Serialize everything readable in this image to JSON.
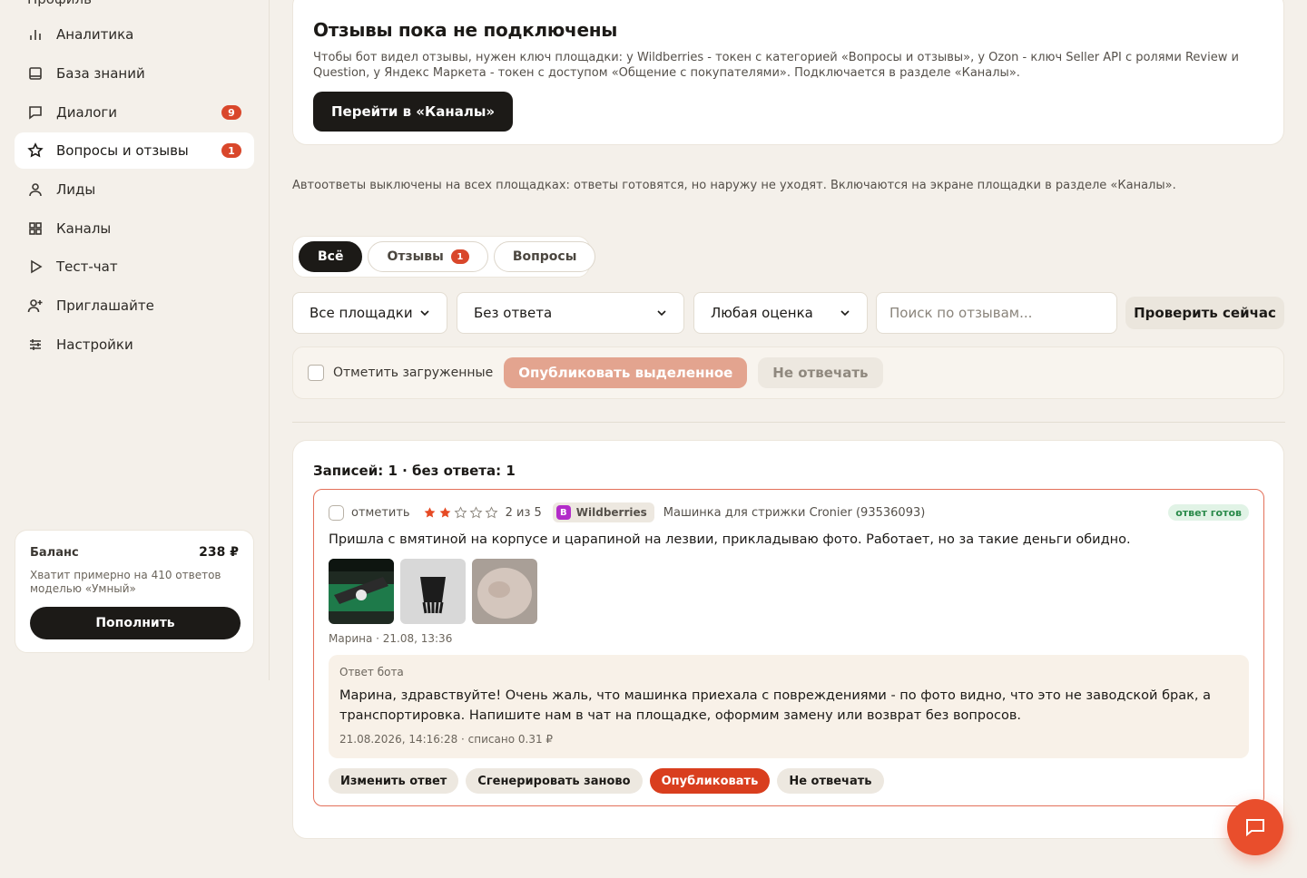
{
  "sidebar": {
    "cut_item": "Профиль",
    "items": [
      {
        "label": "Аналитика",
        "icon": "bar-chart-icon"
      },
      {
        "label": "База знаний",
        "icon": "book-icon"
      },
      {
        "label": "Диалоги",
        "icon": "chat-icon",
        "badge": "9"
      },
      {
        "label": "Вопросы и отзывы",
        "icon": "star-icon",
        "badge": "1",
        "active": true
      },
      {
        "label": "Лиды",
        "icon": "user-icon"
      },
      {
        "label": "Каналы",
        "icon": "grid-icon"
      },
      {
        "label": "Тест-чат",
        "icon": "play-icon"
      },
      {
        "label": "Приглашайте",
        "icon": "user-plus-icon"
      },
      {
        "label": "Настройки",
        "icon": "sliders-icon"
      }
    ],
    "balance": {
      "title": "Баланс",
      "amount": "238 ₽",
      "description": "Хватит примерно на 410 ответов моделью «Умный»",
      "button": "Пополнить"
    }
  },
  "notice": {
    "title": "Отзывы пока не подключены",
    "text": "Чтобы бот видел отзывы, нужен ключ площадки: у Wildberries - токен с категорией «Вопросы и отзывы», у Ozon - ключ Seller API с ролями Review и Question, у Яндекс Маркета - токен с доступом «Общение с покупателями». Подключается в разделе «Каналы».",
    "button": "Перейти в «Каналы»"
  },
  "autoreply_note": "Автоответы выключены на всех площадках: ответы готовятся, но наружу не уходят. Включаются на экране площадки в разделе «Каналы».",
  "tabs": [
    {
      "label": "Всё",
      "active": true
    },
    {
      "label": "Отзывы",
      "badge": "1"
    },
    {
      "label": "Вопросы"
    }
  ],
  "filters": {
    "platform": "Все площадки",
    "status": "Без ответа",
    "rating": "Любая оценка",
    "search_placeholder": "Поиск по отзывам...",
    "check_now": "Проверить сейчас"
  },
  "bulk": {
    "mark_loaded": "Отметить загруженные",
    "publish_selected": "Опубликовать выделенное",
    "skip": "Не отвечать"
  },
  "list": {
    "count_text": "Записей: 1 · без ответа: 1",
    "review": {
      "mark_label": "отметить",
      "rating": 2,
      "rating_max": 5,
      "rating_text": "2 из 5",
      "platform": "Wildberries",
      "platform_logo": "B",
      "product": "Машинка для стрижки Cronier (93536093)",
      "status": "ответ готов",
      "text": "Пришла с вмятиной на корпусе и царапиной на лезвии, прикладываю фото. Работает, но за такие деньги обидно.",
      "photos": [
        "photo-clipper-box",
        "photo-clipper-blade",
        "photo-damage-closeup"
      ],
      "author_meta": "Марина · 21.08, 13:36",
      "bot_label": "Ответ бота",
      "bot_text": "Марина, здравствуйте! Очень жаль, что машинка приехала с повреждениями - по фото видно, что это не заводской брак, а транспортировка. Напишите нам в чат на площадке, оформим замену или возврат без вопросов.",
      "bot_meta": "21.08.2026, 14:16:28 · списано 0.31 ₽",
      "actions": {
        "edit": "Изменить ответ",
        "regenerate": "Сгенерировать заново",
        "publish": "Опубликовать",
        "skip": "Не отвечать"
      }
    }
  },
  "colors": {
    "accent": "#d93e1e",
    "badge": "#d9472b",
    "dark": "#1c1a17",
    "background": "#f4f0ea"
  }
}
